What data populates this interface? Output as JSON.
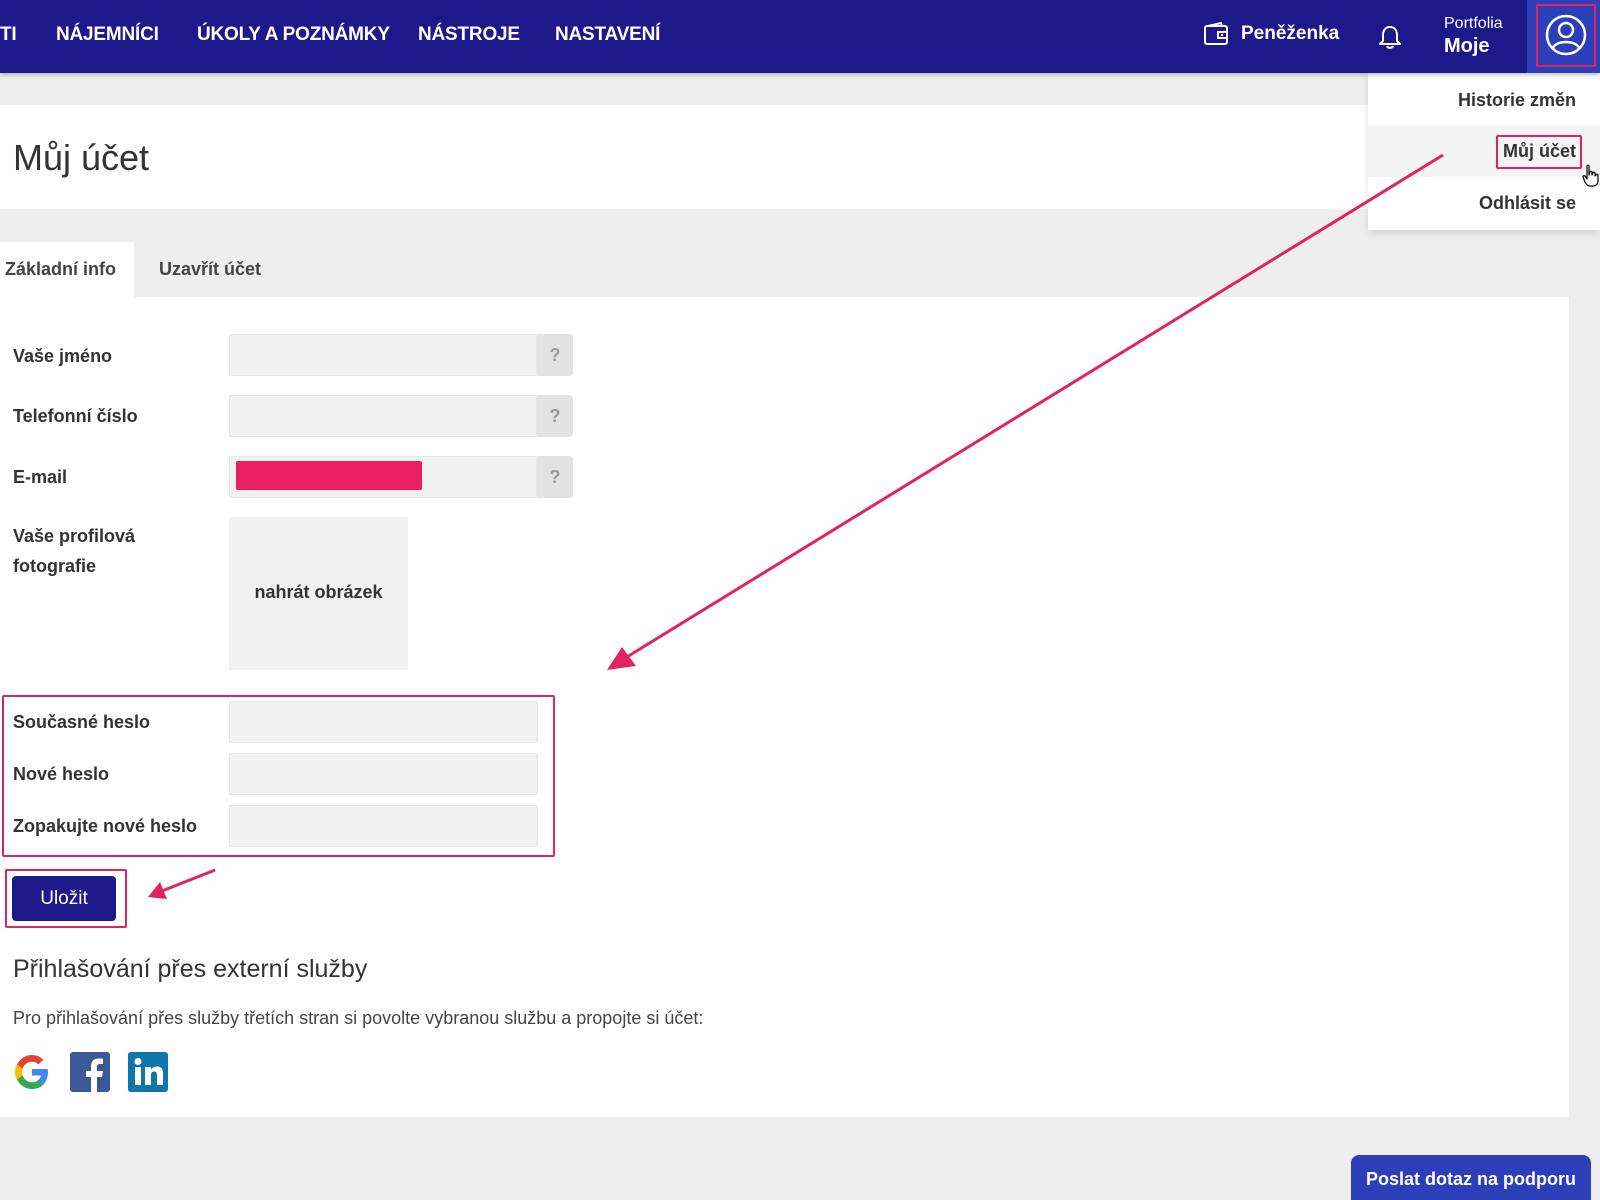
{
  "nav": {
    "items": [
      "TI",
      "NÁJEMNÍCI",
      "ÚKOLY A POZNÁMKY",
      "NÁSTROJE",
      "NASTAVENÍ"
    ],
    "wallet_label": "Peněženka",
    "portfolio_label": "Portfolia",
    "portfolio_value": "Moje"
  },
  "user_menu": {
    "items": [
      "Historie změn",
      "Můj účet",
      "Odhlásit se"
    ]
  },
  "page": {
    "title": "Můj účet"
  },
  "tabs": [
    "Základní info",
    "Uzavřít účet"
  ],
  "form": {
    "name_label": "Vaše jméno",
    "phone_label": "Telefonní číslo",
    "email_label": "E-mail",
    "photo_label_line1": "Vaše profilová",
    "photo_label_line2": "fotografie",
    "upload_label": "nahrát obrázek",
    "help_glyph": "?",
    "current_password_label": "Současné heslo",
    "new_password_label": "Nové heslo",
    "repeat_password_label": "Zopakujte nové heslo",
    "save_label": "Uložit"
  },
  "external": {
    "title": "Přihlašování přes externí služby",
    "description": "Pro přihlašování přes služby třetích stran si povolte vybranou službu a propojte si účet:",
    "services": [
      "google-icon",
      "facebook-icon",
      "linkedin-icon"
    ]
  },
  "support_button": "Poslat dotaz na podporu",
  "colors": {
    "primary": "#1c1a8a",
    "accent": "#2c3eb8",
    "annotation": "#e0245e",
    "redaction": "#e91e63"
  }
}
